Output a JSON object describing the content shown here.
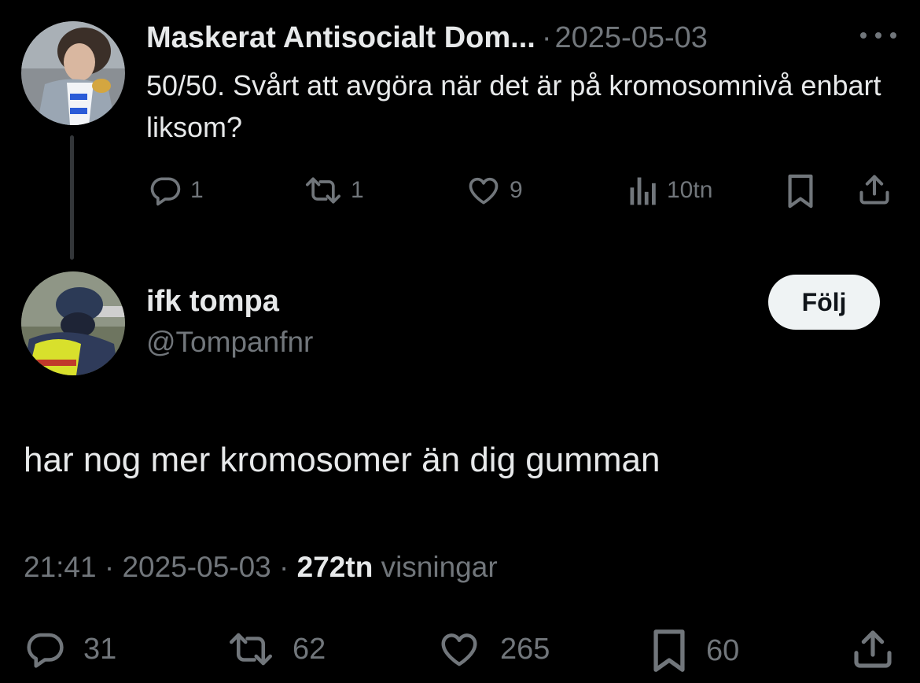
{
  "parent_tweet": {
    "display_name": "Maskerat Antisocialt Dom...",
    "separator": "·",
    "date": "2025-05-03",
    "text": "50/50. Svårt att avgöra när det är på kromosomnivå enbart liksom?",
    "actions": {
      "replies": "1",
      "retweets": "1",
      "likes": "9",
      "views": "10tn"
    },
    "icons": [
      "more-icon",
      "reply-icon",
      "retweet-icon",
      "like-icon",
      "views-icon",
      "bookmark-icon",
      "share-icon"
    ]
  },
  "reply_tweet": {
    "display_name": "ifk tompa",
    "handle": "@Tompanfnr",
    "follow_label": "Följ",
    "text": "har nog mer kromosomer än dig gumman",
    "meta": {
      "time": "21:41",
      "sep1": " · ",
      "date": "2025-05-03",
      "sep2": " · ",
      "views_count": "272tn",
      "views_label": " visningar"
    },
    "actions": {
      "replies": "31",
      "retweets": "62",
      "likes": "265",
      "bookmarks": "60"
    }
  },
  "colors": {
    "background": "#000000",
    "text": "#e7e9ea",
    "muted": "#71767b",
    "follow_button_bg": "#eff3f4"
  }
}
